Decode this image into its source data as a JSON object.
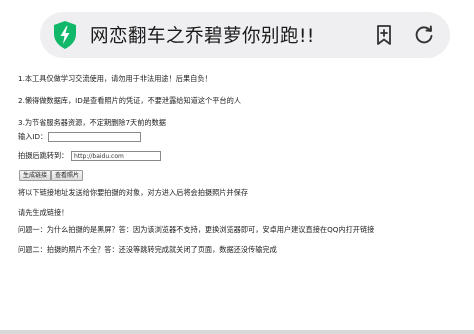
{
  "browser": {
    "title": "网恋翻车之乔碧萝你别跑!!",
    "icons": {
      "site": "shield-icon",
      "bookmark": "bookmark-add-icon",
      "refresh": "refresh-icon"
    }
  },
  "notices": [
    "1.本工具仅做学习交流使用，请勿用于非法用途！后果自负！",
    "2.懒得做数据库，ID是查看照片的凭证，不要泄露给知道这个平台的人",
    "3.为节省服务器资源，不定期删除7天前的数据"
  ],
  "form": {
    "id_label": "输入ID：",
    "id_value": "",
    "redirect_label": "拍摄后跳转到：",
    "redirect_value": "http://baidu.com",
    "generate_label": "生成链接",
    "view_label": "查看照片"
  },
  "messages": {
    "share_hint": "将以下链接地址发送给你要拍摄的对象，对方进入后将会拍摄照片并保存",
    "generate_prompt": "请先生成链接！",
    "faq1": "问题一：为什么拍摄的是黑屏？答：因为该浏览器不支持，更换浏览器即可，安卓用户建议直接在QQ内打开链接",
    "faq2": "问题二：拍摄的照片不全？答：还没等跳转完成就关闭了页面，数据还没传输完成"
  },
  "colors": {
    "shield": "#12b86a",
    "url_bar_bg": "#efeff1"
  }
}
